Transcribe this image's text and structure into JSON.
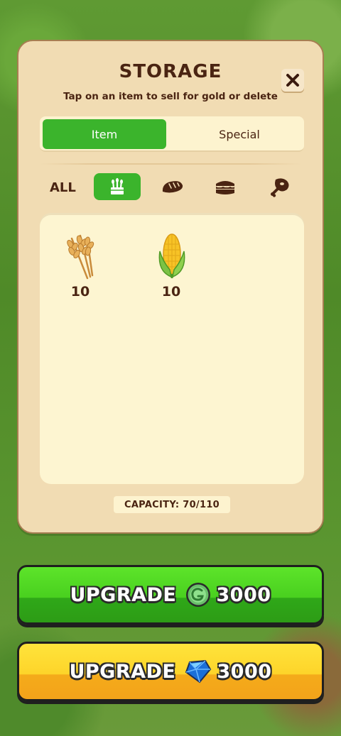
{
  "storage": {
    "title": "STORAGE",
    "subtitle": "Tap on an item to sell for gold or delete",
    "tabs": [
      {
        "label": "Item",
        "active": true
      },
      {
        "label": "Special",
        "active": false
      }
    ],
    "filters": {
      "all_label": "ALL",
      "categories": [
        {
          "icon": "crops-icon",
          "active": true
        },
        {
          "icon": "bread-icon",
          "active": false
        },
        {
          "icon": "sandwich-icon",
          "active": false
        },
        {
          "icon": "meat-icon",
          "active": false
        }
      ]
    },
    "items": [
      {
        "icon": "wheat-icon",
        "quantity": "10"
      },
      {
        "icon": "corn-icon",
        "quantity": "10"
      }
    ],
    "capacity_text": "CAPACITY: 70/110"
  },
  "upgrade_gold": {
    "label": "UPGRADE",
    "cost": "3000",
    "currency_icon": "gold-coin-icon",
    "color": "#49d01f"
  },
  "upgrade_gem": {
    "label": "UPGRADE",
    "cost": "3000",
    "currency_icon": "gem-icon",
    "color": "#fdd42a"
  }
}
